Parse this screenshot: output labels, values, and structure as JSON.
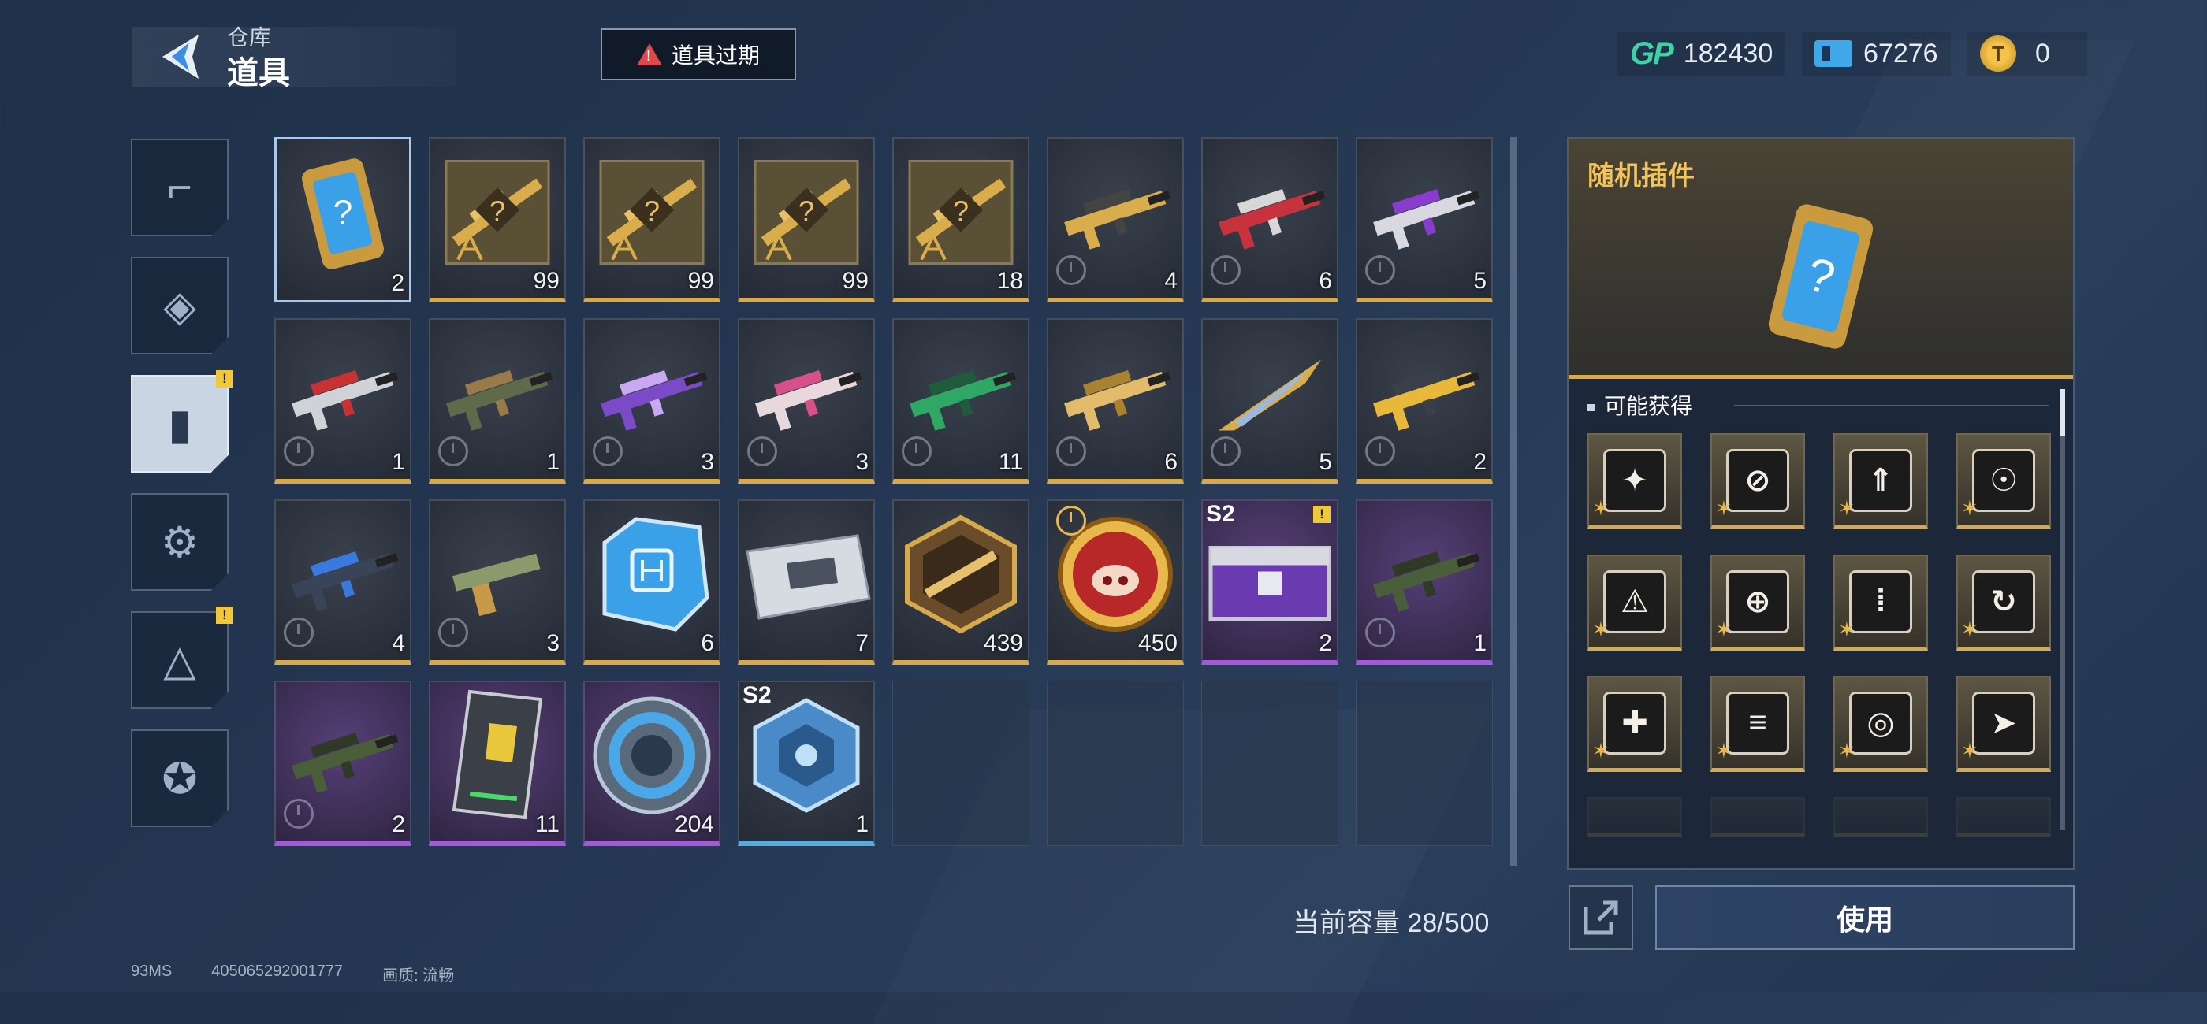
{
  "header": {
    "breadcrumb_parent": "仓库",
    "page_title": "道具",
    "expired_button_label": "道具过期",
    "currencies": [
      {
        "name": "gp",
        "icon": "gp-icon",
        "label": "GP",
        "value": "182430"
      },
      {
        "name": "ticket",
        "icon": "ticket-icon",
        "value": "67276"
      },
      {
        "name": "coin",
        "icon": "coin-icon",
        "value": "0"
      }
    ]
  },
  "sidebar": {
    "tabs": [
      {
        "name": "weapons",
        "icon": "pistol-icon",
        "active": false,
        "badge": ""
      },
      {
        "name": "frames",
        "icon": "frame-icon",
        "active": false,
        "badge": ""
      },
      {
        "name": "items",
        "icon": "card-icon",
        "active": true,
        "badge": "!"
      },
      {
        "name": "attachments",
        "icon": "attachment-icon",
        "active": false,
        "badge": ""
      },
      {
        "name": "blueprints",
        "icon": "blueprint-icon",
        "active": false,
        "badge": "!"
      },
      {
        "name": "badges",
        "icon": "star-badge-icon",
        "active": false,
        "badge": ""
      }
    ]
  },
  "inventory": {
    "items": [
      {
        "icon": "mystery-card-icon",
        "qty": "2",
        "rarity": "gold",
        "selected": true
      },
      {
        "icon": "mystery-rifle-blueprint-icon",
        "qty": "99",
        "rarity": "gold"
      },
      {
        "icon": "mystery-rifle-blueprint-icon",
        "qty": "99",
        "rarity": "gold"
      },
      {
        "icon": "mystery-rifle-blueprint-icon",
        "qty": "99",
        "rarity": "gold"
      },
      {
        "icon": "mystery-rifle-blueprint-icon",
        "qty": "18",
        "rarity": "gold"
      },
      {
        "icon": "gold-rifle-skin-icon",
        "qty": "4",
        "rarity": "gold",
        "timed": true
      },
      {
        "icon": "red-rifle-skin-icon",
        "qty": "6",
        "rarity": "gold",
        "timed": true
      },
      {
        "icon": "purple-rifle-skin-icon",
        "qty": "5",
        "rarity": "gold",
        "timed": true
      },
      {
        "icon": "red-smg-skin-icon",
        "qty": "1",
        "rarity": "gold",
        "timed": true
      },
      {
        "icon": "camo-smg-skin-icon",
        "qty": "1",
        "rarity": "gold",
        "timed": true
      },
      {
        "icon": "violet-rifle-skin-icon",
        "qty": "3",
        "rarity": "gold",
        "timed": true
      },
      {
        "icon": "pink-rifle-skin-icon",
        "qty": "3",
        "rarity": "gold",
        "timed": true
      },
      {
        "icon": "green-rifle-skin-icon",
        "qty": "11",
        "rarity": "gold",
        "timed": true
      },
      {
        "icon": "golden-rifle-skin-icon",
        "qty": "6",
        "rarity": "gold",
        "timed": true
      },
      {
        "icon": "knife-skin-icon",
        "qty": "5",
        "rarity": "gold",
        "timed": true
      },
      {
        "icon": "yellow-rifle-skin-icon",
        "qty": "2",
        "rarity": "gold",
        "timed": true
      },
      {
        "icon": "blue-rifle-skin-icon",
        "qty": "4",
        "rarity": "gold",
        "timed": true
      },
      {
        "icon": "pistol-skin-icon",
        "qty": "3",
        "rarity": "gold",
        "timed": true
      },
      {
        "icon": "chip-icon",
        "qty": "6",
        "rarity": "gold"
      },
      {
        "icon": "silver-case-icon",
        "qty": "7",
        "rarity": "gold"
      },
      {
        "icon": "rifle-emblem-icon",
        "qty": "439",
        "rarity": "gold"
      },
      {
        "icon": "pig-coin-icon",
        "qty": "450",
        "rarity": "gold",
        "clock_top": true
      },
      {
        "icon": "purple-crate-icon",
        "qty": "2",
        "rarity": "purple",
        "season": "S2",
        "alert": "!"
      },
      {
        "icon": "green-lmg-skin-icon",
        "qty": "1",
        "rarity": "purple",
        "timed": true
      },
      {
        "icon": "green-lmg-skin-icon",
        "qty": "2",
        "rarity": "purple",
        "timed": true
      },
      {
        "icon": "card-pack-icon",
        "qty": "11",
        "rarity": "purple"
      },
      {
        "icon": "blue-token-icon",
        "qty": "204",
        "rarity": "purple"
      },
      {
        "icon": "blue-cube-icon",
        "qty": "1",
        "rarity": "blue",
        "season": "S2"
      },
      {
        "empty": true
      },
      {
        "empty": true
      },
      {
        "empty": true
      },
      {
        "empty": true
      }
    ]
  },
  "capacity": {
    "label": "当前容量 28/500"
  },
  "footer": {
    "ping": "93MS",
    "uid": "405065292001777",
    "quality": "画质: 流畅"
  },
  "detail": {
    "title": "随机插件",
    "drops_label": "可能获得",
    "drops": [
      {
        "icon": "damage-up-icon",
        "glyph": "✦"
      },
      {
        "icon": "no-recoil-icon",
        "glyph": "⊘"
      },
      {
        "icon": "ammo-up-icon",
        "glyph": "⇑"
      },
      {
        "icon": "headshot-icon",
        "glyph": "☉"
      },
      {
        "icon": "warning-ammo-icon",
        "glyph": "⚠"
      },
      {
        "icon": "crosshair-icon",
        "glyph": "⊕"
      },
      {
        "icon": "bullets-icon",
        "glyph": "⁞"
      },
      {
        "icon": "reload-icon",
        "glyph": "↻"
      },
      {
        "icon": "cross-shield-icon",
        "glyph": "✚"
      },
      {
        "icon": "rate-up-icon",
        "glyph": "≡"
      },
      {
        "icon": "target-up-icon",
        "glyph": "◎"
      },
      {
        "icon": "dash-icon",
        "glyph": "➤"
      },
      {
        "icon": "plugin-icon",
        "glyph": "",
        "faded": true
      },
      {
        "icon": "plugin-icon",
        "glyph": "",
        "faded": true
      },
      {
        "icon": "plugin-icon",
        "glyph": "",
        "faded": true
      },
      {
        "icon": "plugin-icon",
        "glyph": "",
        "faded": true
      }
    ],
    "use_button_label": "使用"
  },
  "colors": {
    "accent_gold": "#d6a94d",
    "accent_purple": "#a35ad8",
    "accent_blue": "#5aaae0",
    "warning": "#e04848"
  }
}
